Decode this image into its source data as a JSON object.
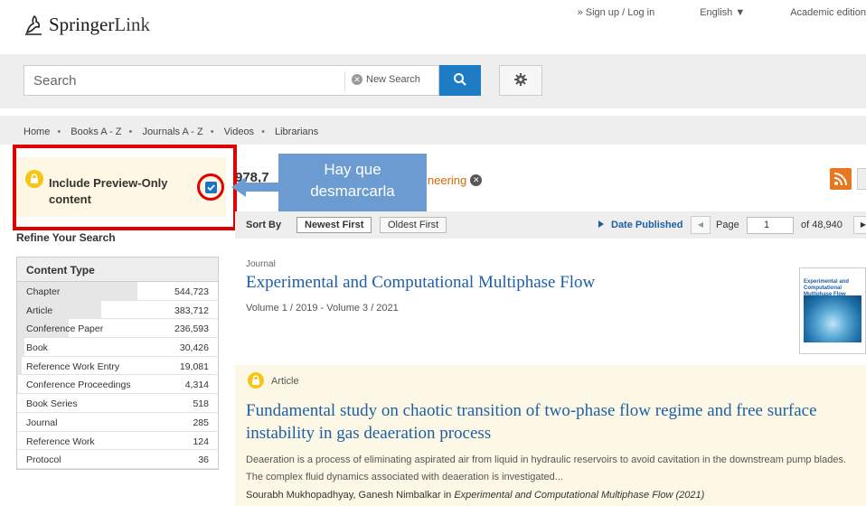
{
  "header": {
    "logo_text": "Springer",
    "logo_text_light": "Link",
    "signup_login": "» Sign up / Log in",
    "language": "English",
    "language_arrow": "▼",
    "academic_edition": "Academic edition"
  },
  "search": {
    "placeholder": "Search",
    "new_search_label": "New Search",
    "search_icon": "search-icon",
    "gear_icon": "gear-icon"
  },
  "nav": {
    "items": [
      "Home",
      "Books A - Z",
      "Journals A - Z",
      "Videos",
      "Librarians"
    ],
    "separator": "•"
  },
  "preview_filter": {
    "label": "Include Preview-Only content",
    "checked": true
  },
  "annotation": {
    "callout_line1": "Hay que",
    "callout_line2": "desmarcarla"
  },
  "results": {
    "count_prefix": "978,7",
    "facet_suffix": "ineering"
  },
  "sort": {
    "label": "Sort By",
    "newest": "Newest First",
    "oldest": "Oldest First",
    "date_published": "Date Published",
    "page_label": "Page",
    "page_value": "1",
    "of_pages": "of 48,940"
  },
  "sidebar": {
    "refine_title": "Refine Your Search",
    "content_type_title": "Content Type",
    "items": [
      {
        "name": "Chapter",
        "count": "544,723",
        "fill": 1.0
      },
      {
        "name": "Article",
        "count": "383,712",
        "fill": 0.7
      },
      {
        "name": "Conference Paper",
        "count": "236,593",
        "fill": 0.43
      },
      {
        "name": "Book",
        "count": "30,426",
        "fill": 0.06
      },
      {
        "name": "Reference Work Entry",
        "count": "19,081",
        "fill": 0.04
      },
      {
        "name": "Conference Proceedings",
        "count": "4,314",
        "fill": 0.01
      },
      {
        "name": "Book Series",
        "count": "518",
        "fill": 0.0
      },
      {
        "name": "Journal",
        "count": "285",
        "fill": 0.0
      },
      {
        "name": "Reference Work",
        "count": "124",
        "fill": 0.0
      },
      {
        "name": "Protocol",
        "count": "36",
        "fill": 0.0
      }
    ]
  },
  "result1": {
    "type": "Journal",
    "title": "Experimental and Computational Multiphase Flow",
    "volumes": "Volume 1 / 2019 - Volume 3 / 2021",
    "cover_title": "Experimental and Computational Multiphase Flow"
  },
  "result2": {
    "type": "Article",
    "title": "Fundamental study on chaotic transition of two-phase flow regime and free surface instability in gas deaeration process",
    "snippet": "Deaeration is a process of eliminating aspirated air from liquid in hydraulic reservoirs to avoid cavitation in the downstream pump blades. The complex fluid dynamics associated with deaeration is investigated...",
    "authors": "Sourabh Mukhopadhyay, Ganesh Nimbalkar in ",
    "journal": "Experimental and Computational Multiphase Flow (2021)"
  },
  "colors": {
    "accent_blue": "#1d7cc4",
    "link_blue": "#1d5fa5",
    "highlight_red": "#e00000",
    "callout_blue": "#6b9bd1",
    "lock_yellow": "#f5c518",
    "facet_orange": "#d66a00"
  }
}
